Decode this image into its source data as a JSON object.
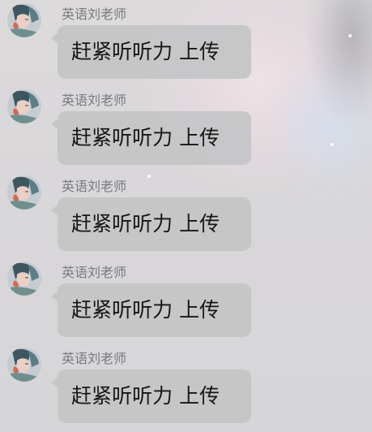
{
  "messages": [
    {
      "sender": "英语刘老师",
      "text": "赶紧听听力 上传"
    },
    {
      "sender": "英语刘老师",
      "text": "赶紧听听力 上传"
    },
    {
      "sender": "英语刘老师",
      "text": "赶紧听听力 上传"
    },
    {
      "sender": "英语刘老师",
      "text": "赶紧听听力 上传"
    },
    {
      "sender": "英语刘老师",
      "text": "赶紧听听力 上传"
    }
  ]
}
